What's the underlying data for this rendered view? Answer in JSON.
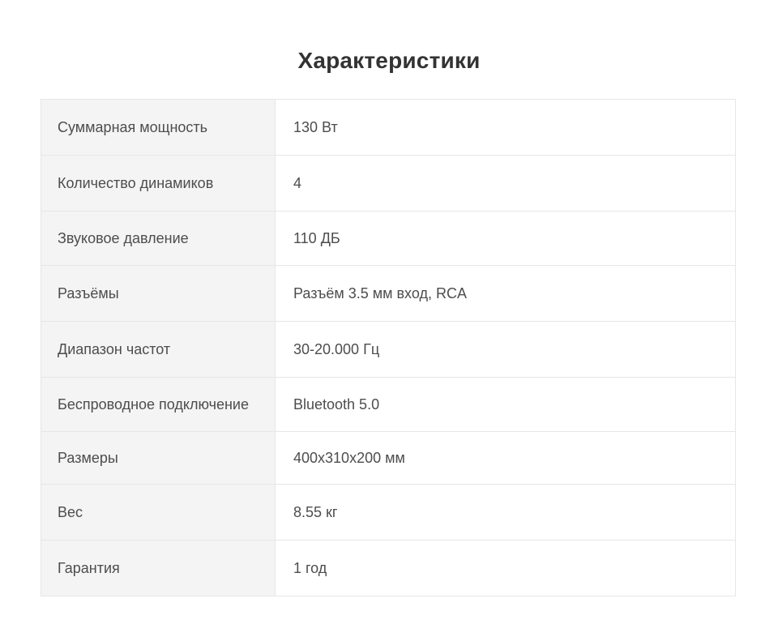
{
  "title": "Характеристики",
  "specs": [
    {
      "label": "Суммарная мощность",
      "value": "130 Вт"
    },
    {
      "label": "Количество динамиков",
      "value": "4"
    },
    {
      "label": "Звуковое давление",
      "value": "110 ДБ"
    },
    {
      "label": "Разъёмы",
      "value": "Разъём 3.5 мм вход, RCA"
    },
    {
      "label": "Диапазон частот",
      "value": "30-20.000 Гц"
    },
    {
      "label": "Беспроводное подключение",
      "value": "Bluetooth 5.0"
    },
    {
      "label": "Размеры",
      "value": "400x310x200 мм"
    },
    {
      "label": "Вес",
      "value": "8.55 кг"
    },
    {
      "label": "Гарантия",
      "value": "1 год"
    }
  ]
}
